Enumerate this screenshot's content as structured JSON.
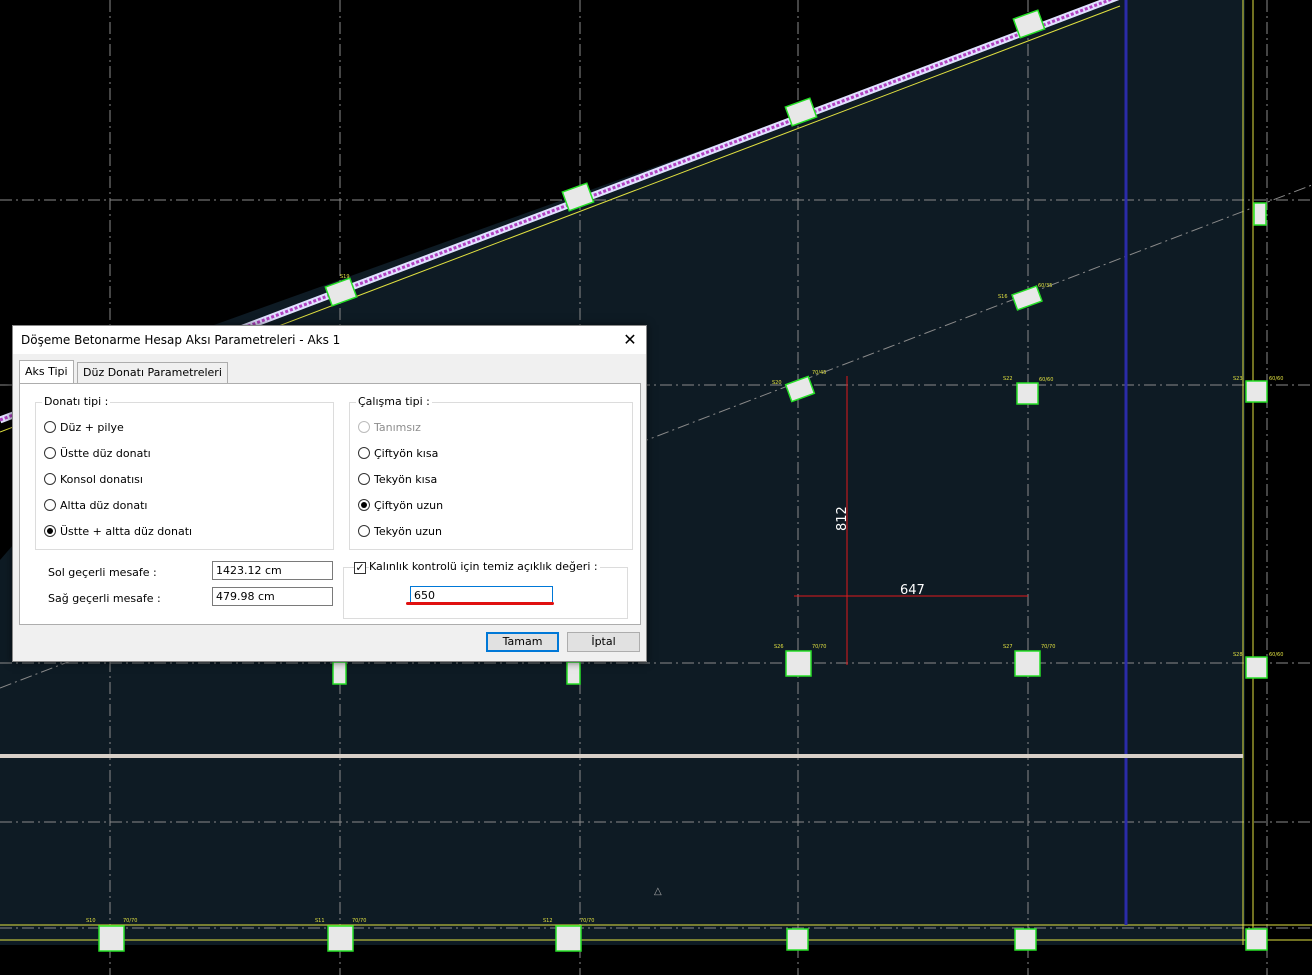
{
  "cad": {
    "columns": [
      "S10",
      "S11",
      "S12",
      "S16",
      "S19",
      "S20",
      "S22",
      "S23",
      "S26",
      "S27",
      "S28"
    ],
    "column_sizes": [
      "70/70",
      "70/70",
      "70/70",
      "60/60",
      "70/70",
      "70/70",
      "60/60"
    ],
    "dimensions": {
      "vertical": "812",
      "horizontal": "647"
    },
    "colors": {
      "background": "#000000",
      "slab": "#0e1b24",
      "column": "#27e027",
      "dimension": "#e0191b",
      "grid": "#9a9a9a",
      "axis_blue": "#2b2ba8",
      "wall": "#c8c8ff"
    }
  },
  "dialog": {
    "title": "Döşeme Betonarme Hesap Aksı Parametreleri - Aks 1",
    "close_icon": "close-icon",
    "tabs": [
      {
        "label": "Aks Tipi",
        "active": true
      },
      {
        "label": "Düz Donatı Parametreleri",
        "active": false
      }
    ],
    "donati_tipi": {
      "label": "Donatı tipi :",
      "options": [
        {
          "label": "Düz + pilye",
          "checked": false
        },
        {
          "label": "Üstte düz donatı",
          "checked": false
        },
        {
          "label": "Konsol donatısı",
          "checked": false
        },
        {
          "label": "Altta düz donatı",
          "checked": false
        },
        {
          "label": "Üstte + altta düz donatı",
          "checked": true
        }
      ]
    },
    "calisma_tipi": {
      "label": "Çalışma tipi :",
      "options": [
        {
          "label": "Tanımsız",
          "checked": false,
          "disabled": true
        },
        {
          "label": "Çiftyön kısa",
          "checked": false
        },
        {
          "label": "Tekyön kısa",
          "checked": false
        },
        {
          "label": "Çiftyön uzun",
          "checked": true
        },
        {
          "label": "Tekyön uzun",
          "checked": false
        }
      ]
    },
    "sol_label": "Sol geçerli mesafe :",
    "sol_value": "1423.12 cm",
    "sag_label": "Sağ geçerli mesafe :",
    "sag_value": "479.98 cm",
    "kalinlik_label": "Kalınlık kontrolü için temiz açıklık değeri :",
    "kalinlik_checked": true,
    "kalinlik_value": "650",
    "ok_label": "Tamam",
    "cancel_label": "İptal"
  }
}
